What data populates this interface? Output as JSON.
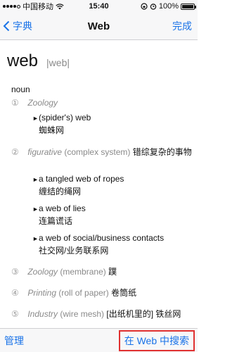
{
  "status_bar": {
    "carrier": "中国移动",
    "time": "15:40",
    "battery": "100%",
    "battery_level": 1.0
  },
  "nav": {
    "back_label": "字典",
    "title": "Web",
    "done_label": "完成"
  },
  "entry": {
    "headword": "web",
    "pronunciation": "|web|",
    "pos": "noun",
    "senses": [
      {
        "num": "①",
        "label": "Zoology",
        "examples": [
          {
            "en": "(spider's) web",
            "zh": "蜘蛛网"
          }
        ]
      },
      {
        "num": "②",
        "label": "figurative",
        "paren": "(complex system)",
        "translation": "错综复杂的事物",
        "examples": [
          {
            "en": "a tangled web of ropes",
            "zh": "缠结的绳网"
          },
          {
            "en": "a web of lies",
            "zh": "连篇谎话"
          },
          {
            "en": "a web of social/business contacts",
            "zh": "社交网/业务联系网"
          }
        ]
      },
      {
        "num": "③",
        "label": "Zoology",
        "paren": "(membrane)",
        "translation": "蹼"
      },
      {
        "num": "④",
        "label": "Printing",
        "paren": "(roll of paper)",
        "translation": "卷筒纸"
      },
      {
        "num": "⑤",
        "label": "Industry",
        "paren": "(wire mesh)",
        "translation": "[出纸机里的] 铁丝网"
      }
    ]
  },
  "toolbar": {
    "manage_label": "管理",
    "search_web_label": "在 Web 中搜索"
  },
  "colors": {
    "accent": "#1a73e8",
    "highlight_border": "#e03030"
  }
}
